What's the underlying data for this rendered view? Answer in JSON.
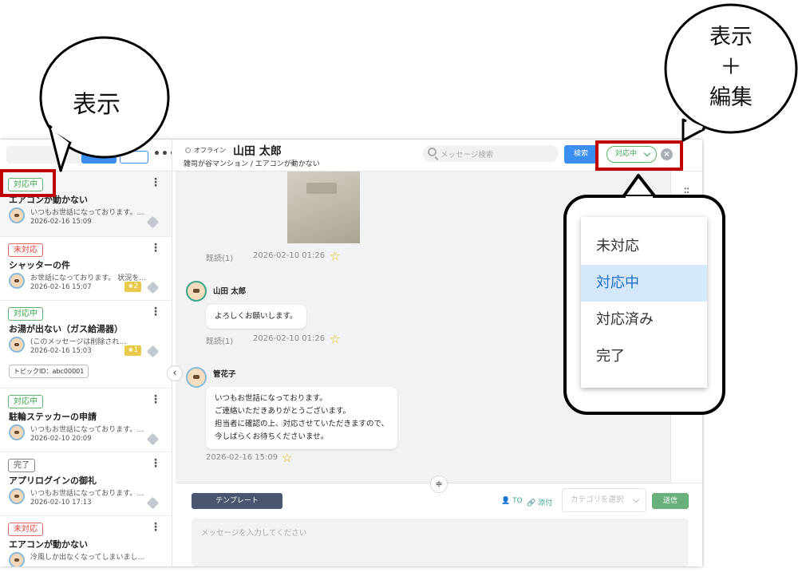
{
  "sidebar": {
    "conversations": [
      {
        "status": "対応中",
        "status_color": "green",
        "title": "エアコンが動かない",
        "preview": "いつもお世話になっております。…",
        "date": "2026-02-16 15:09",
        "selected": true
      },
      {
        "status": "未対応",
        "status_color": "red",
        "title": "シャッターの件",
        "preview": "お世話になっております。 状況を…",
        "date": "2026-02-16 15:07",
        "star_count": "★2"
      },
      {
        "status": "対応中",
        "status_color": "green",
        "title": "お湯が出ない（ガス給湯器）",
        "preview": "(このメッセージは削除され…",
        "date": "2026-02-16 15:03",
        "star_count": "★1",
        "topic": "トピックID：abc00001"
      },
      {
        "status": "対応中",
        "status_color": "green",
        "title": "駐輪ステッカーの申請",
        "preview": "いつもお世話になっております。…",
        "date": "2026-02-10 20:09"
      },
      {
        "status": "完了",
        "status_color": "gray",
        "title": "アプリログインの御礼",
        "preview": "いつもお世話になっております。…",
        "date": "2026-02-10 17:13"
      },
      {
        "status": "未対応",
        "status_color": "red",
        "title": "エアコンが動かない",
        "preview": "冷風しか出なくなってしまいまし…",
        "date": ""
      }
    ]
  },
  "header": {
    "presence": "オフライン",
    "user_name": "山田 太郎",
    "subtitle": "雑司が谷マンション / エアコンが動かない",
    "search_placeholder": "メッセージ検索",
    "search_button": "検索",
    "status_value": "対応中"
  },
  "chat": {
    "messages": [
      {
        "type": "image",
        "read": "既読(1)",
        "time": "2026-02-10 01:26"
      },
      {
        "type": "text",
        "sender": "山田 太郎",
        "text": [
          "よろしくお願いします。"
        ],
        "read": "既読(1)",
        "time": "2026-02-10 01:26"
      },
      {
        "type": "text",
        "sender": "管花子",
        "text": [
          "いつもお世話になっております。",
          "ご連絡いただきありがとうございます。",
          "担当者に確認の上、対応させていただきますので、",
          "今しばらくお待ちくださいませ。"
        ],
        "read": "",
        "time": "2026-02-16 15:09"
      }
    ]
  },
  "composer": {
    "template_button": "テンプレート",
    "to_label": "TO",
    "attach_label": "添付",
    "category_placeholder": "カテゴリを選択",
    "send_button": "送信",
    "message_placeholder": "メッセージを入力してください"
  },
  "annotations": {
    "left_bubble": "表示",
    "right_bubble_lines": [
      "表示",
      "＋",
      "編集"
    ],
    "accent_red": "#c00000"
  },
  "status_dropdown": {
    "options": [
      "未対応",
      "対応中",
      "対応済み",
      "完了"
    ],
    "selected": "対応中"
  }
}
